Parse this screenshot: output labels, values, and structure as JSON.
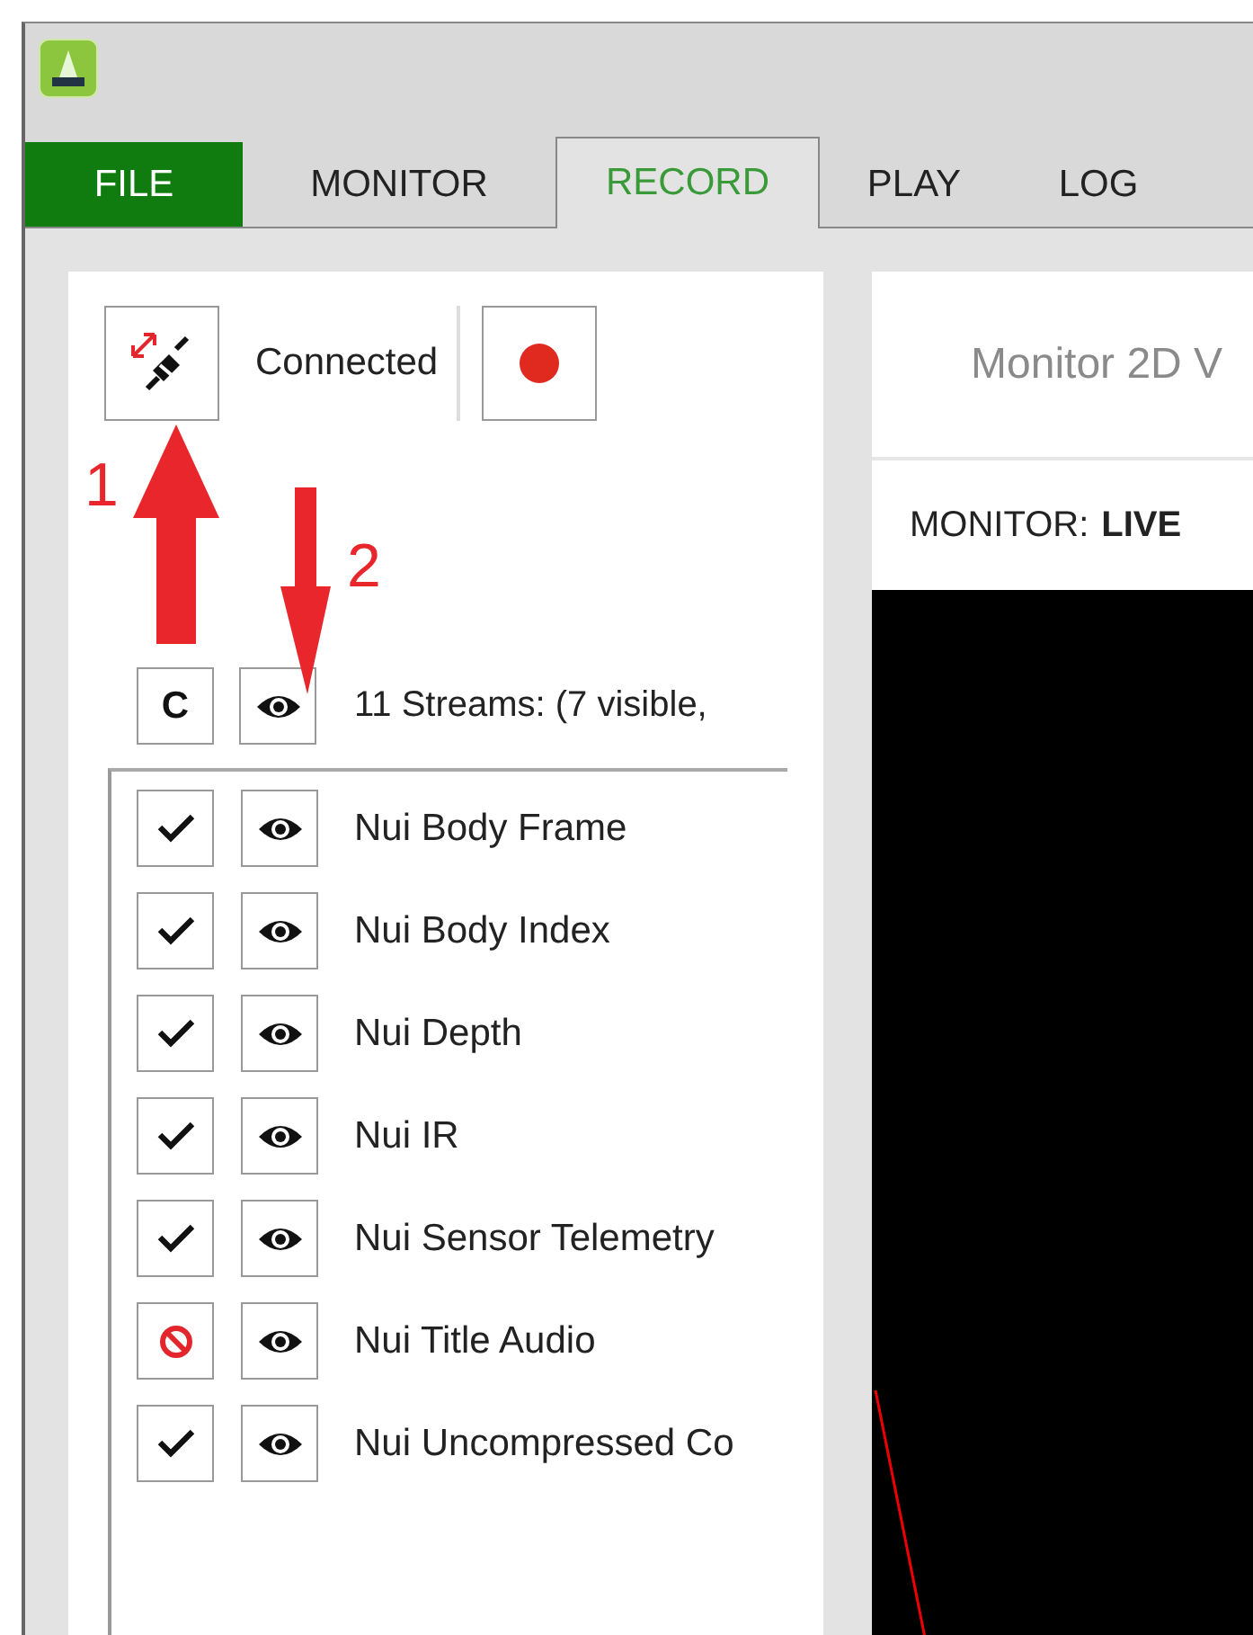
{
  "file_menu": {
    "label": "FILE"
  },
  "tabs": [
    {
      "label": "MONITOR",
      "selected": false
    },
    {
      "label": "RECORD",
      "selected": true
    },
    {
      "label": "PLAY",
      "selected": false
    },
    {
      "label": "LOG",
      "selected": false
    }
  ],
  "connection": {
    "status": "Connected"
  },
  "streams": {
    "clear_label": "C",
    "summary": "11 Streams: (7 visible,",
    "items": [
      {
        "name": "Nui Body Frame",
        "record": true,
        "visible": true
      },
      {
        "name": "Nui Body Index",
        "record": true,
        "visible": true
      },
      {
        "name": "Nui Depth",
        "record": true,
        "visible": true
      },
      {
        "name": "Nui IR",
        "record": true,
        "visible": true
      },
      {
        "name": "Nui Sensor Telemetry",
        "record": true,
        "visible": true
      },
      {
        "name": "Nui Title Audio",
        "record": false,
        "visible": true
      },
      {
        "name": "Nui Uncompressed Co",
        "record": true,
        "visible": true
      }
    ]
  },
  "annotations": [
    {
      "label": "1",
      "kind": "up"
    },
    {
      "label": "2",
      "kind": "down"
    }
  ],
  "monitor": {
    "title": "Monitor 2D V",
    "mode_label": "MONITOR:",
    "mode_value": "LIVE"
  }
}
